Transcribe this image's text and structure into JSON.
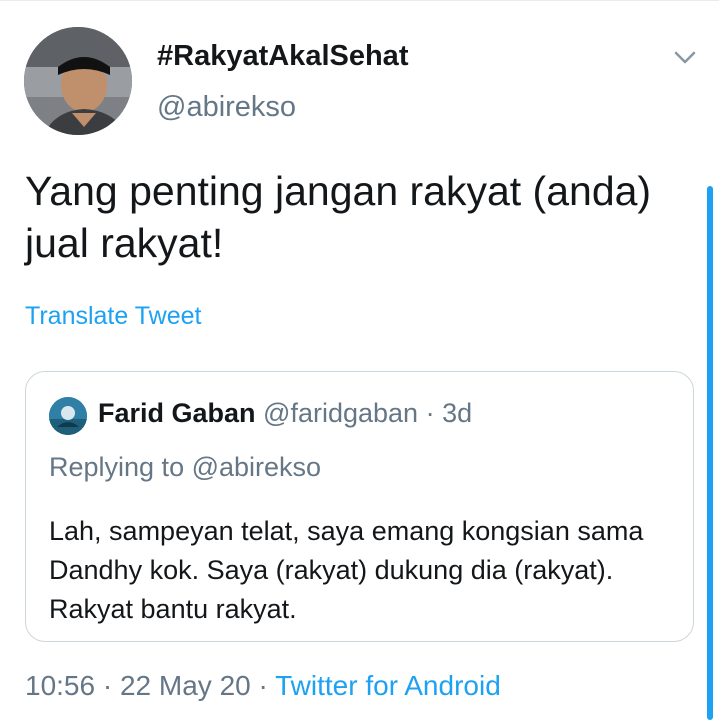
{
  "tweet": {
    "display_name": "#RakyatAkalSehat",
    "handle": "@abirekso",
    "text": "Yang penting jangan rakyat (anda) jual rakyat!",
    "translate_label": "Translate Tweet",
    "caret_icon": "chevron-down-icon"
  },
  "quoted_tweet": {
    "display_name": "Farid Gaban",
    "handle": "@faridgaban",
    "separator": "·",
    "time": "3d",
    "replying_to": "Replying to @abirekso",
    "text": "Lah, sampeyan telat, saya emang kongsian sama Dandhy kok. Saya (rakyat) dukung dia (rakyat). Rakyat bantu rakyat."
  },
  "meta": {
    "time": "10:56",
    "separator1": "·",
    "date": "22 May 20",
    "separator2": "·",
    "source": "Twitter for Android"
  },
  "colors": {
    "text": "#14171a",
    "secondary": "#657786",
    "link": "#1da1f2",
    "border": "#ccd6dd"
  }
}
